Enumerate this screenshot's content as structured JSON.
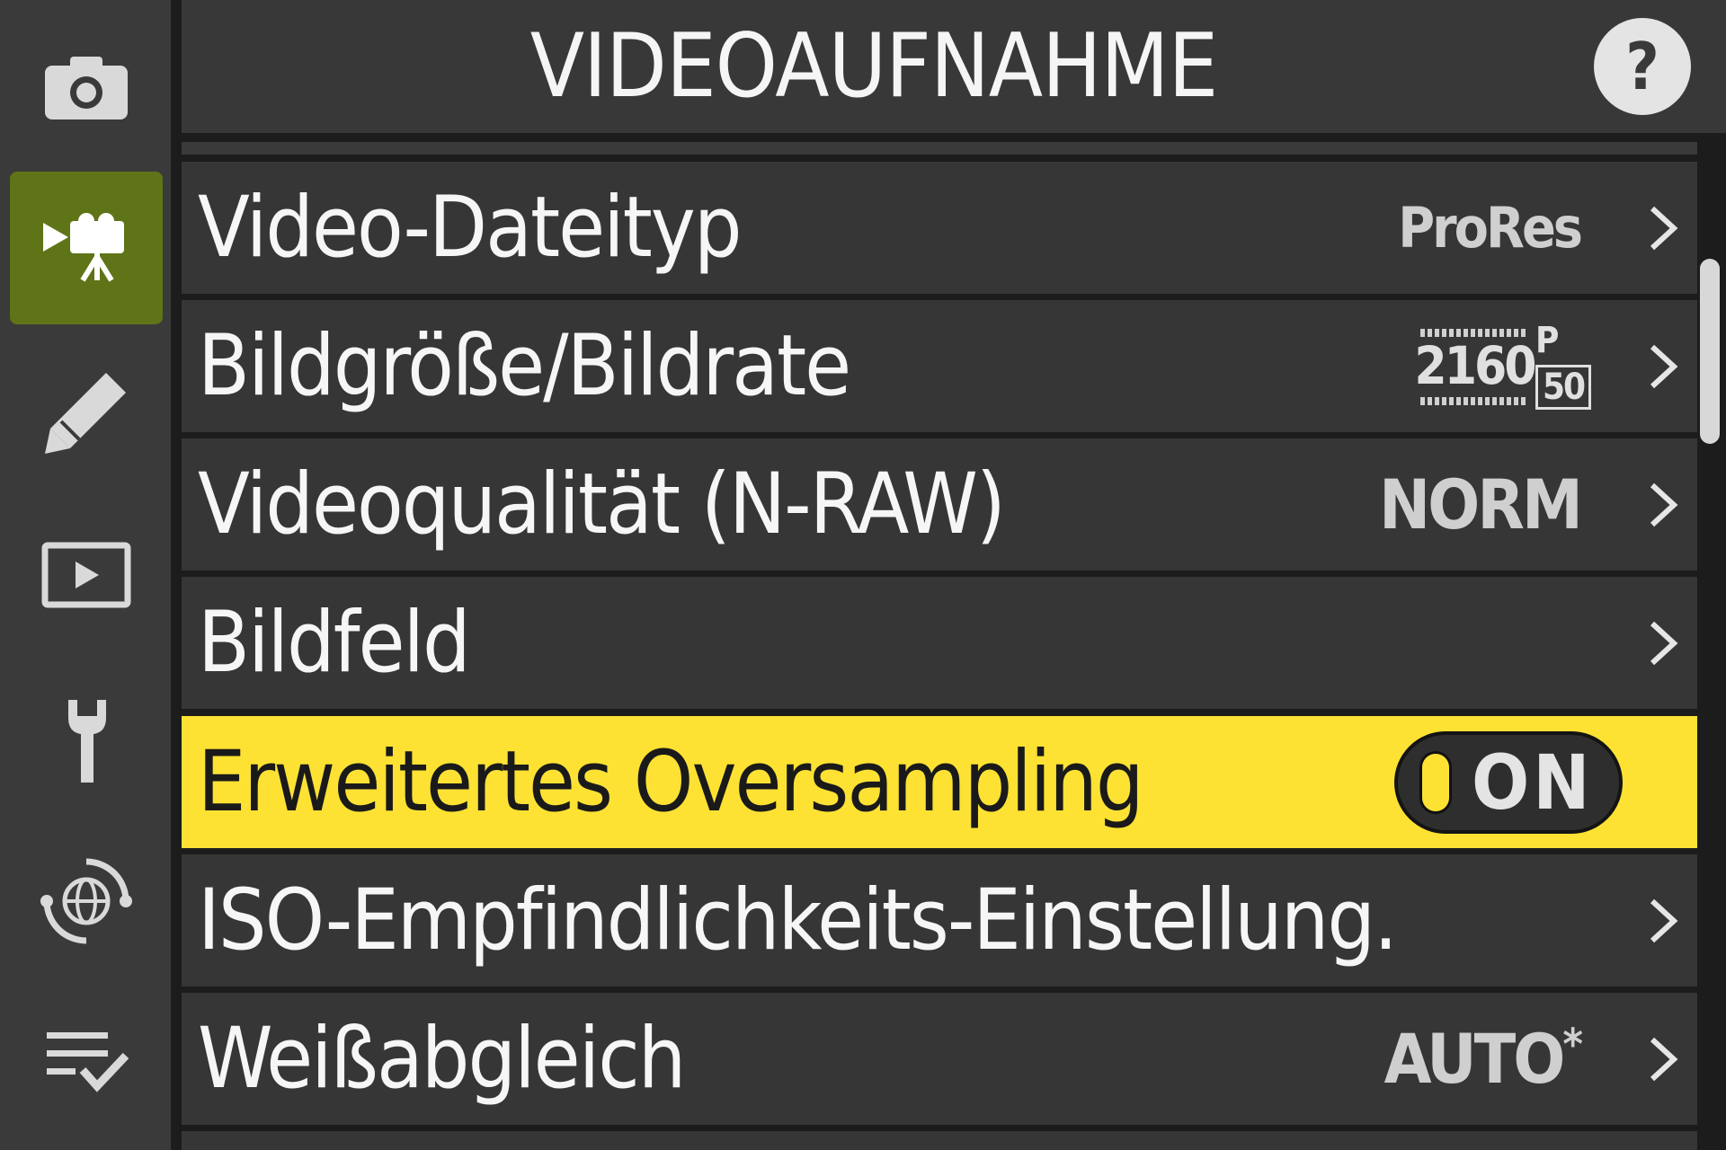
{
  "sidebar": {
    "tabs": [
      {
        "icon": "camera-icon"
      },
      {
        "icon": "video-camera-icon"
      },
      {
        "icon": "pencil-icon"
      },
      {
        "icon": "playback-icon"
      },
      {
        "icon": "wrench-icon"
      },
      {
        "icon": "network-globe-icon"
      },
      {
        "icon": "my-menu-checklist-icon"
      }
    ],
    "active_index": 1
  },
  "header": {
    "title": "VIDEOAUFNAHME",
    "help_label": "?"
  },
  "menu": {
    "items": [
      {
        "label": "Video-Dateityp",
        "value": "ProRes"
      },
      {
        "label": "Bildgröße/Bildrate",
        "value": {
          "resolution": "2160",
          "scan": "P",
          "fps": "50"
        }
      },
      {
        "label": "Videoqualität (N-RAW)",
        "value": "NORM"
      },
      {
        "label": "Bildfeld",
        "value": ""
      },
      {
        "label": "Erweitertes Oversampling",
        "value": "ON",
        "selected": true
      },
      {
        "label": "ISO-Empfindlichkeits-Einstellung.",
        "value": ""
      },
      {
        "label": "Weißabgleich",
        "value": "AUTO",
        "value_suffix": "*"
      }
    ]
  },
  "colors": {
    "accent_selected": "#fde233",
    "active_tab": "#5e7417",
    "row_bg": "#363636",
    "sidebar_bg": "#3a3a3a"
  }
}
